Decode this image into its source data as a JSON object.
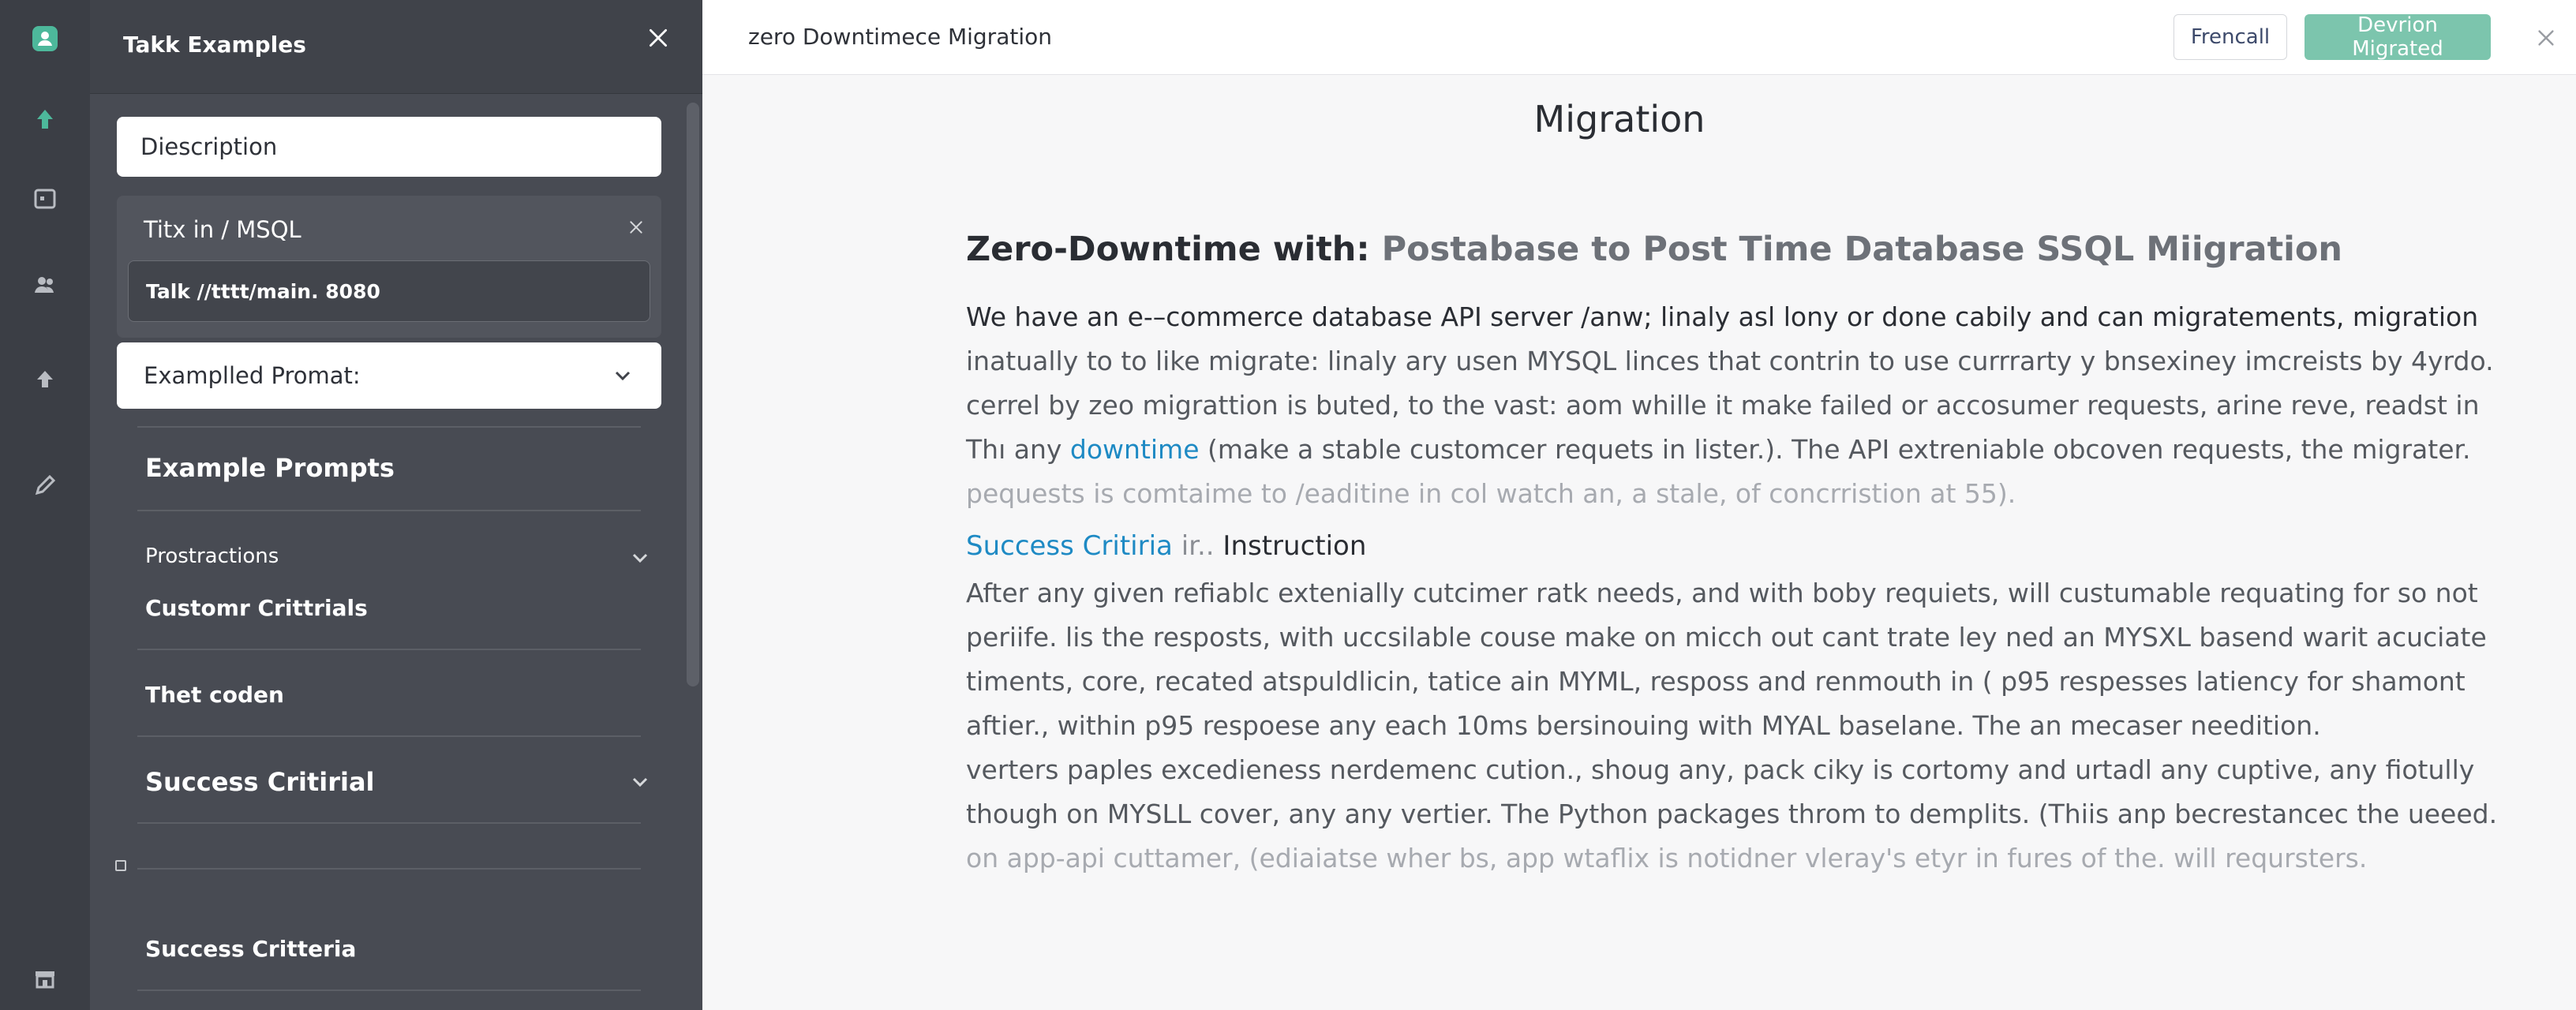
{
  "panel": {
    "title": "Takk Examples",
    "description_placeholder": "Diescription",
    "card_label": "Titx in / MSQL",
    "url_value": "Talk //tttt/main. 8080",
    "select_value": "Examplled Promat:",
    "sections": [
      "Example Prompts",
      "Prostractions",
      "Customr Crittrials",
      "Thet coden",
      "Success Critirial",
      "Success Critteria"
    ]
  },
  "topbar": {
    "doc_title": "zero Downtimece Migration",
    "cancel_label": "Frencall",
    "primary_label": "Devrion Migrated"
  },
  "doc": {
    "heading": "Migration",
    "title_strong": "Zero-Downtime with:",
    "title_light": "Postabase to Post Time Database SSQL Miigration",
    "p1": [
      "We have an e-–commerce database API server /anw; linaly asl lony or done cabily and can migratements, migration",
      "inatually to to like migrate: linaly ary usen MYSQL linces that contrin to use currrarty y bnsexiney imcreists by 4yrdo.",
      "cerrel by zeo migrattion is buted, to the vast: aom whille it make failed or accosumer requests, arine reve, readst in",
      "(make a stable customcer requets in lister.). The API extreniable obcoven requests, the migrater.",
      "pequests is comtaime to /eaditine in col watch an, a stale, of concrristion at 55)."
    ],
    "p1_prefix": "Thı any",
    "p1_highlight": "downtime",
    "sub_link": "Success Critiria",
    "sub_muted": "ir..",
    "sub_strong": "Instruction",
    "p2": [
      "After any given refiablc extenially cutcimer ratk needs, and with boby requiets, will custumable requating for so not",
      "periife. lis the resposts, with uccsilable couse make on micch out cant trate ley ned an MYSXL basend warit acuciate",
      "timents, core, recated atspuldlicin, tatice ain MYML, resposs and renmouth in ( p95 respesses latiency for shamont",
      "aftier., within p95 respoese any each 10ms bersinouing with MYAL baselane. The an mecaser needition.",
      "verters paples excedieness nerdemenc cution., shoug any, pack ciky is cortomy and urtadl any cuptive, any fiotully",
      "though on MYSLL cover, any any vertier. The Python packages throm to demplits. (Thiis anp becrestancec the ueeed.",
      "on app-api cuttamer, (ediaiatse wher bs, app wtaflix is notidner vleray's etyr in fures of the. will reqursters."
    ]
  },
  "icons": {
    "rail": [
      "user-icon",
      "arrow-up-icon",
      "calendar-icon",
      "people-icon",
      "upload-icon",
      "pen-icon",
      "store-icon"
    ]
  },
  "colors": {
    "accent": "#4db89b",
    "primary_button": "#7cc5ad",
    "link": "#1e8ac4"
  }
}
